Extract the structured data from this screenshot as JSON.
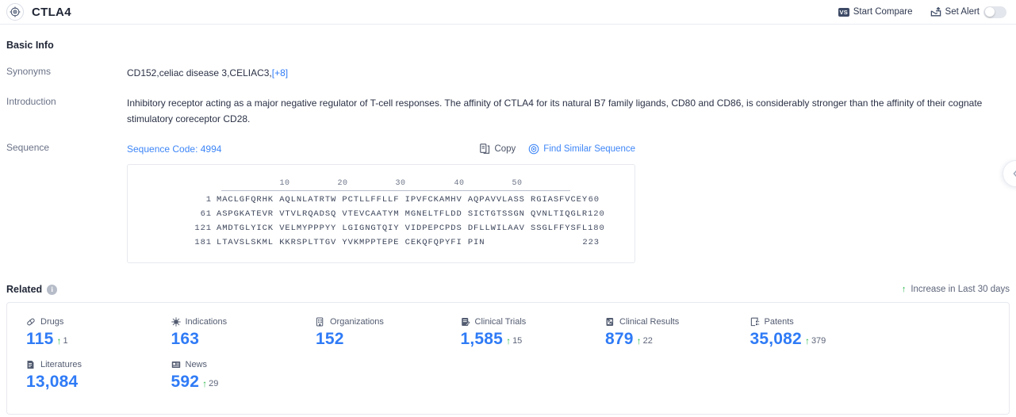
{
  "header": {
    "title": "CTLA4",
    "logo_icon": "target-crosshair-icon",
    "start_compare_label": "Start Compare",
    "start_compare_badge": "VS",
    "set_alert_label": "Set Alert",
    "set_alert_icon": "alert-bell-icon",
    "alert_toggle_state": "off"
  },
  "basic_info": {
    "section_title": "Basic Info",
    "synonyms_label": "Synonyms",
    "synonyms_value": "CD152,celiac disease 3,CELIAC3,",
    "synonyms_more": "[+8]",
    "introduction_label": "Introduction",
    "introduction_value": "Inhibitory receptor acting as a major negative regulator of T-cell responses. The affinity of CTLA4 for its natural B7 family ligands, CD80 and CD86, is considerably stronger than the affinity of their cognate stimulatory coreceptor CD28.",
    "sequence_label": "Sequence"
  },
  "sequence": {
    "code_label": "Sequence Code: 4994",
    "copy_label": "Copy",
    "copy_icon": "copy-icon",
    "find_similar_label": "Find Similar Sequence",
    "find_similar_icon": "find-similar-icon",
    "ruler_ticks": [
      "10",
      "20",
      "30",
      "40",
      "50"
    ],
    "lines": [
      {
        "start": "1",
        "chunks": "MACLGFQRHK AQLNLATRTW PCTLLFFLLF IPVFCKAMHV AQPAVVLASS RGIASFVCEY",
        "end": "60"
      },
      {
        "start": "61",
        "chunks": "ASPGKATEVR VTVLRQADSQ VTEVCAATYM MGNELTFLDD SICTGTSSGN QVNLTIQGLR",
        "end": "120"
      },
      {
        "start": "121",
        "chunks": "AMDTGLYICK VELMYPPPYY LGIGNGTQIY VIDPEPCPDS DFLLWILAAV SSGLFFYSFL",
        "end": "180"
      },
      {
        "start": "181",
        "chunks": "LTAVSLSKML KKRSPLTTGV YVKMPPTEPE CEKQFQPYFI PIN",
        "end": "223"
      }
    ]
  },
  "related": {
    "section_title": "Related",
    "info_icon": "info-icon",
    "legend_label": "Increase in Last 30 days",
    "legend_icon": "up-arrow-icon",
    "stats": [
      {
        "label": "Drugs",
        "icon": "capsule-pill-icon",
        "value": "115",
        "delta": "1"
      },
      {
        "label": "Indications",
        "icon": "virus-icon",
        "value": "163",
        "delta": ""
      },
      {
        "label": "Organizations",
        "icon": "building-icon",
        "value": "152",
        "delta": ""
      },
      {
        "label": "Clinical Trials",
        "icon": "clinical-trial-icon",
        "value": "1,585",
        "delta": "15"
      },
      {
        "label": "Clinical Results",
        "icon": "clinical-result-icon",
        "value": "879",
        "delta": "22"
      },
      {
        "label": "Patents",
        "icon": "patent-icon",
        "value": "35,082",
        "delta": "379"
      },
      {
        "label": "Literatures",
        "icon": "literature-icon",
        "value": "13,084",
        "delta": ""
      },
      {
        "label": "News",
        "icon": "news-icon",
        "value": "592",
        "delta": "29"
      }
    ]
  },
  "edge_fab": {
    "icon": "chevron-left-icon"
  },
  "colors": {
    "accent": "#2f7bf6",
    "link": "#3e86f7",
    "increase": "#2db84d",
    "text": "#20263a"
  }
}
